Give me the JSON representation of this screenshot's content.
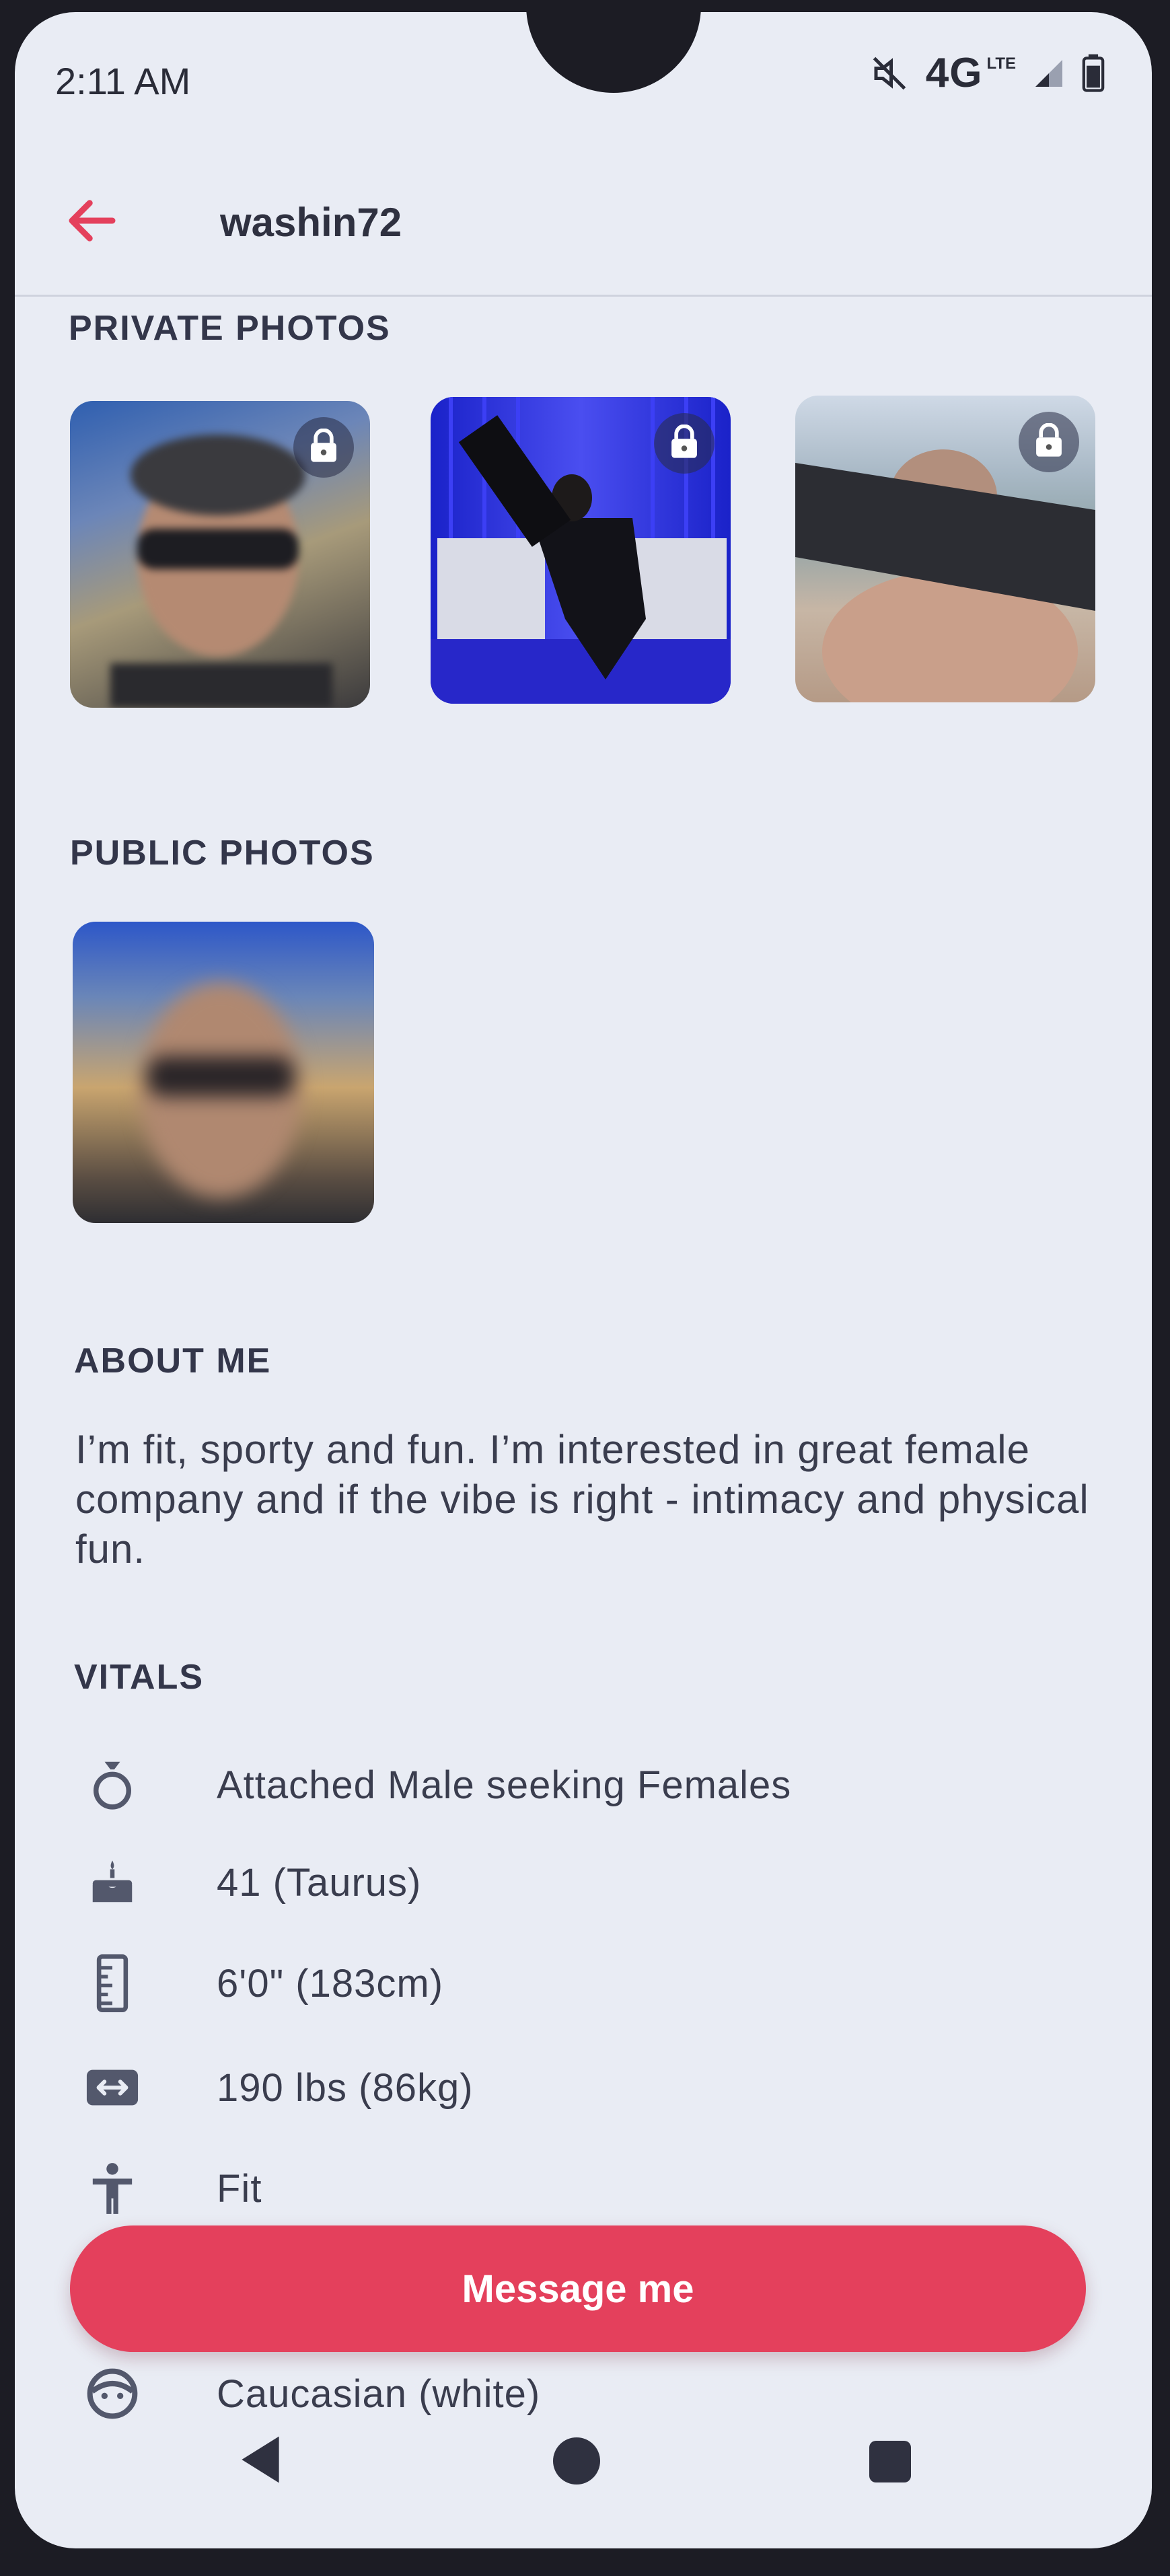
{
  "status_bar": {
    "time": "2:11 AM",
    "network": "4G",
    "network_sub": "LTE"
  },
  "header": {
    "back_icon": "arrow-left-icon",
    "title": "washin72"
  },
  "private_photos": {
    "title": "PRIVATE PHOTOS",
    "photos": [
      {
        "locked": true,
        "icon": "lock-icon"
      },
      {
        "locked": true,
        "icon": "lock-icon"
      },
      {
        "locked": true,
        "icon": "lock-icon"
      }
    ]
  },
  "public_photos": {
    "title": "PUBLIC PHOTOS",
    "count": 1
  },
  "about": {
    "title": "ABOUT ME",
    "text": "I’m fit, sporty and fun. I’m interested in great female company and if the vibe is right - intimacy and physical fun."
  },
  "vitals": {
    "title": "VITALS",
    "items": [
      {
        "icon": "ring-icon",
        "text": "Attached Male seeking Females"
      },
      {
        "icon": "birthday-cake-icon",
        "text": "41 (Taurus)"
      },
      {
        "icon": "ruler-icon",
        "text": "6'0\" (183cm)"
      },
      {
        "icon": "weight-icon",
        "text": "190 lbs (86kg)"
      },
      {
        "icon": "body-type-icon",
        "text": "Fit"
      },
      {
        "icon": "ethnicity-icon",
        "text": "Caucasian (white)"
      }
    ]
  },
  "cta": {
    "label": "Message me"
  },
  "colors": {
    "accent": "#e4405c",
    "background": "#e9ecf4",
    "text": "#3a3d4e"
  }
}
